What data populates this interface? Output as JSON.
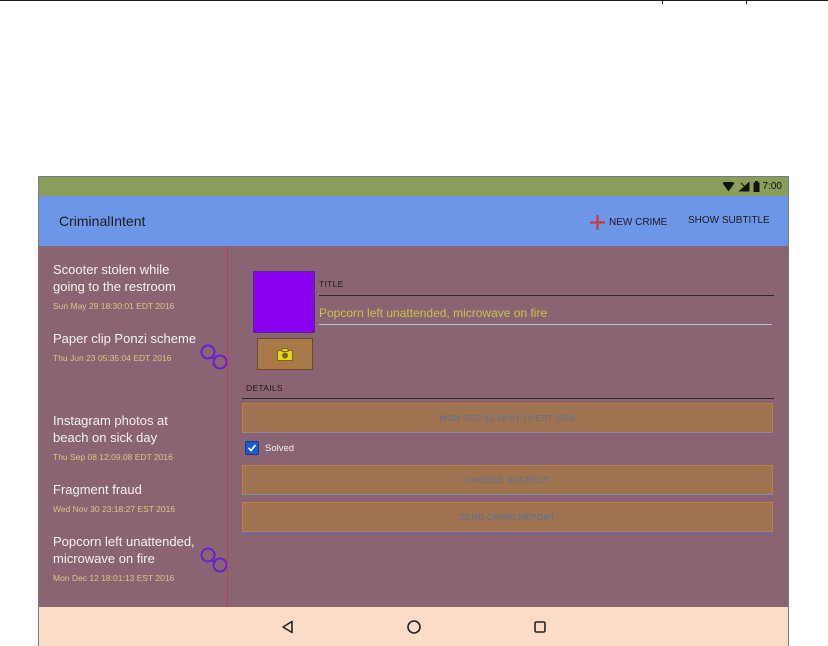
{
  "status": {
    "time": "7:00"
  },
  "toolbar": {
    "title": "CriminalIntent",
    "new_crime_label": "NEW CRIME",
    "show_subtitle_label": "SHOW SUBTITLE"
  },
  "crimes": [
    {
      "title": "Scooter stolen while going to the restroom",
      "date": "Sun May 29 18:30:01 EDT 2016",
      "solved": false
    },
    {
      "title": "Paper clip Ponzi scheme",
      "date": "Thu Jun 23 05:35:04 EDT 2016",
      "solved": true
    },
    {
      "title": "Instagram photos at beach on sick day",
      "date": "Thu Sep 08 12:09:08 EDT 2016",
      "solved": false
    },
    {
      "title": "Fragment fraud",
      "date": "Wed Nov 30 23:18:27 EST 2016",
      "solved": false
    },
    {
      "title": "Popcorn left unattended, microwave on fire",
      "date": "Mon Dec 12 18:01:13 EST 2016",
      "solved": true
    }
  ],
  "detail": {
    "title_label": "TITLE",
    "title_value": "Popcorn left unattended, microwave on fire",
    "details_label": "DETAILS",
    "date_button": "MON DEC 12 18:01:13 EST 2016",
    "solved_label": "Solved",
    "solved": true,
    "suspect_button": "CHOOSE SUSPECT",
    "report_button": "SEND CRIME REPORT"
  },
  "colors": {
    "status_bar": "#8a9e5c",
    "app_bar": "#6e96e8",
    "content_bg": "#8a6472",
    "photo": "#8a00f0",
    "button": "#9e7450",
    "nav_bar": "#fadcc8"
  }
}
